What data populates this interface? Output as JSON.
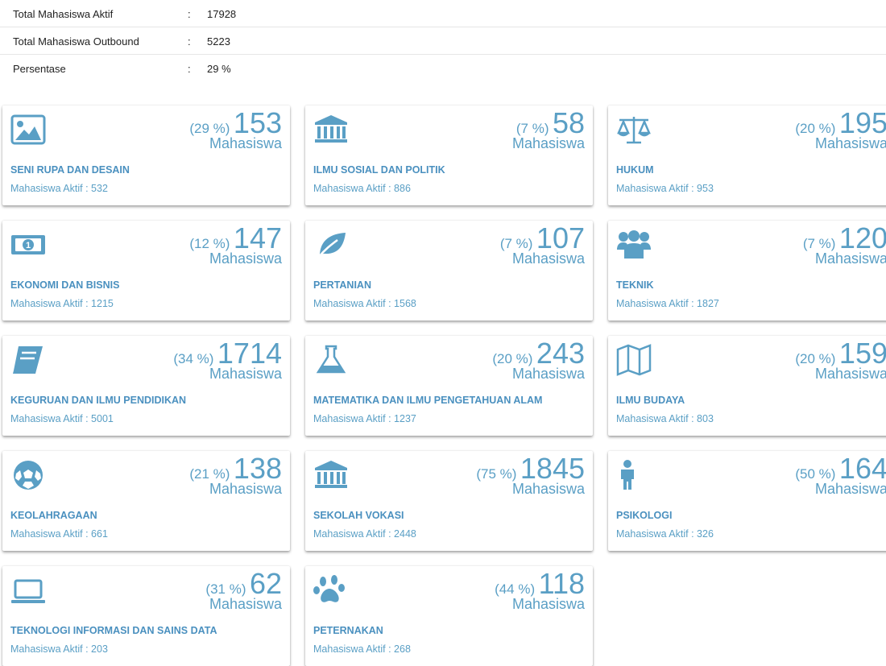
{
  "summary": [
    {
      "label": "Total Mahasiswa Aktif",
      "colon": ":",
      "value": "17928"
    },
    {
      "label": "Total Mahasiswa Outbound",
      "colon": ":",
      "value": "5223"
    },
    {
      "label": "Persentase",
      "colon": ":",
      "value": "29 %"
    }
  ],
  "unit_label": "Mahasiswa",
  "accent_color": "#5a9fc5",
  "cards": [
    {
      "icon": "image-icon",
      "pct": "(29 %)",
      "count": "153",
      "name": "SENI RUPA DAN DESAIN",
      "active": "Mahasiswa Aktif : 532"
    },
    {
      "icon": "institution-icon",
      "pct": "(7 %)",
      "count": "58",
      "name": "ILMU SOSIAL DAN POLITIK",
      "active": "Mahasiswa Aktif : 886"
    },
    {
      "icon": "balance-scale-icon",
      "pct": "(20 %)",
      "count": "195",
      "name": "HUKUM",
      "active": "Mahasiswa Aktif : 953"
    },
    {
      "icon": "money-icon",
      "pct": "(12 %)",
      "count": "147",
      "name": "EKONOMI DAN BISNIS",
      "active": "Mahasiswa Aktif : 1215"
    },
    {
      "icon": "leaf-icon",
      "pct": "(7 %)",
      "count": "107",
      "name": "PERTANIAN",
      "active": "Mahasiswa Aktif : 1568"
    },
    {
      "icon": "users-icon",
      "pct": "(7 %)",
      "count": "120",
      "name": "TEKNIK",
      "active": "Mahasiswa Aktif : 1827"
    },
    {
      "icon": "book-icon",
      "pct": "(34 %)",
      "count": "1714",
      "name": "KEGURUAN DAN ILMU PENDIDIKAN",
      "active": "Mahasiswa Aktif : 5001"
    },
    {
      "icon": "flask-icon",
      "pct": "(20 %)",
      "count": "243",
      "name": "MATEMATIKA DAN ILMU PENGETAHUAN ALAM",
      "active": "Mahasiswa Aktif : 1237"
    },
    {
      "icon": "map-icon",
      "pct": "(20 %)",
      "count": "159",
      "name": "ILMU BUDAYA",
      "active": "Mahasiswa Aktif : 803"
    },
    {
      "icon": "soccer-ball-icon",
      "pct": "(21 %)",
      "count": "138",
      "name": "KEOLAHRAGAAN",
      "active": "Mahasiswa Aktif : 661"
    },
    {
      "icon": "institution-icon",
      "pct": "(75 %)",
      "count": "1845",
      "name": "SEKOLAH VOKASI",
      "active": "Mahasiswa Aktif : 2448"
    },
    {
      "icon": "child-icon",
      "pct": "(50 %)",
      "count": "164",
      "name": "PSIKOLOGI",
      "active": "Mahasiswa Aktif : 326"
    },
    {
      "icon": "laptop-icon",
      "pct": "(31 %)",
      "count": "62",
      "name": "TEKNOLOGI INFORMASI DAN SAINS DATA",
      "active": "Mahasiswa Aktif : 203"
    },
    {
      "icon": "paw-icon",
      "pct": "(44 %)",
      "count": "118",
      "name": "PETERNAKAN",
      "active": "Mahasiswa Aktif : 268"
    }
  ]
}
